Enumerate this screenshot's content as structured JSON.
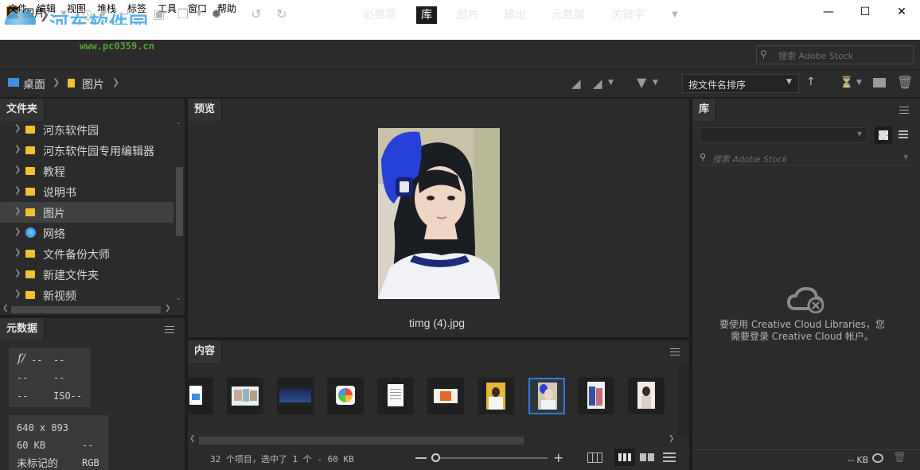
{
  "titlebar": {
    "logo_text": "Br",
    "title": "图片",
    "minimize_icon": "minimize-icon",
    "maximize_icon": "maximize-icon",
    "close_icon": "close-icon",
    "watermark": "河东软件园",
    "watermark_url": "www.pc0359.cn"
  },
  "menubar": {
    "items": [
      "文件",
      "编辑",
      "视图",
      "堆栈",
      "标签",
      "工具",
      "窗口",
      "帮助"
    ]
  },
  "toolbar": {
    "workspaces": [
      {
        "label": "必要项",
        "active": false
      },
      {
        "label": "库",
        "active": true
      },
      {
        "label": "胶片",
        "active": false
      },
      {
        "label": "输出",
        "active": false
      },
      {
        "label": "元数据",
        "active": false
      },
      {
        "label": "关键字",
        "active": false
      }
    ],
    "search_placeholder": "搜索 Adobe Stock"
  },
  "pathbar": {
    "crumbs": [
      "桌面",
      "图片"
    ],
    "sort_label": "按文件名排序"
  },
  "folders": {
    "title": "文件夹",
    "items": [
      {
        "label": "河东软件园",
        "selected": false,
        "icon": "folder-icon"
      },
      {
        "label": "河东软件园专用编辑器",
        "selected": false,
        "icon": "folder-icon"
      },
      {
        "label": "教程",
        "selected": false,
        "icon": "folder-icon"
      },
      {
        "label": "说明书",
        "selected": false,
        "icon": "folder-icon"
      },
      {
        "label": "图片",
        "selected": true,
        "icon": "folder-icon"
      },
      {
        "label": "网络",
        "selected": false,
        "icon": "network-icon"
      },
      {
        "label": "文件备份大师",
        "selected": false,
        "icon": "folder-icon"
      },
      {
        "label": "新建文件夹",
        "selected": false,
        "icon": "folder-icon"
      },
      {
        "label": "新视频",
        "selected": false,
        "icon": "folder-icon"
      }
    ]
  },
  "metadata": {
    "title": "元数据",
    "camera": {
      "f_label": "f/",
      "aperture": "--",
      "shutter": "--",
      "row2_left": "--",
      "row2_right": "--",
      "row3_left": "--",
      "iso": "ISO--"
    },
    "file": {
      "dimensions": "640 x 893",
      "size": "60 KB",
      "size_right": "--",
      "label": "未标记的",
      "mode": "RGB"
    }
  },
  "preview": {
    "title": "预览",
    "caption": "timg (4).jpg"
  },
  "content": {
    "title": "内容",
    "status": "32 个项目，选中了 1 个 - 60 KB",
    "thumbnails": [
      {
        "kind": "document",
        "selected": false
      },
      {
        "kind": "collage",
        "selected": false
      },
      {
        "kind": "night",
        "selected": false
      },
      {
        "kind": "photos-app",
        "selected": false
      },
      {
        "kind": "text",
        "selected": false
      },
      {
        "kind": "map",
        "selected": false
      },
      {
        "kind": "yellow-portrait",
        "selected": false
      },
      {
        "kind": "girl-headphones",
        "selected": true
      },
      {
        "kind": "anime-girls",
        "selected": false
      },
      {
        "kind": "portrait-girl",
        "selected": false
      }
    ]
  },
  "library": {
    "title": "库",
    "search_placeholder": "搜索 Adobe Stock",
    "message_line1": "要使用 Creative Cloud Libraries，您",
    "message_line2": "需要登录 Creative Cloud 帐户。",
    "footer_size": "-- KB"
  },
  "colors": {
    "panel": "#2b2b2b",
    "background": "#1d1d1d",
    "accent": "#2e7bd6",
    "folder": "#f1c232"
  }
}
